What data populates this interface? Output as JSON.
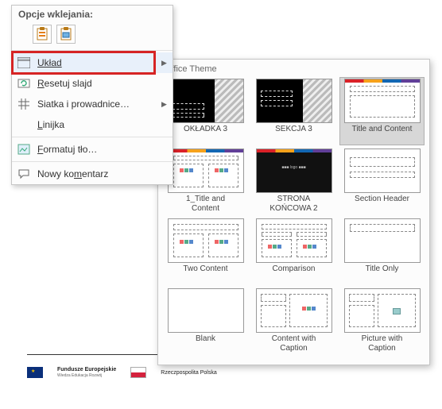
{
  "context_menu": {
    "paste_header": "Opcje wklejania:",
    "items": {
      "layout": {
        "label": "Układ",
        "has_submenu": true
      },
      "reset": {
        "label": "Resetuj slajd"
      },
      "grid": {
        "label": "Siatka i prowadnice…",
        "has_submenu": true
      },
      "ruler": {
        "label": "Linijka"
      },
      "format_bg": {
        "label": "Formatuj tło…"
      },
      "comment": {
        "label": "Nowy komentarz"
      }
    }
  },
  "flyout": {
    "title": "Office Theme",
    "layouts": [
      {
        "key": "okladka3",
        "label": "OKŁADKA 3",
        "kind": "cover-black"
      },
      {
        "key": "sekcja3",
        "label": "SEKCJA 3",
        "kind": "section-black"
      },
      {
        "key": "titlecontent",
        "label": "Title and Content",
        "kind": "title-content",
        "selected": true
      },
      {
        "key": "1title",
        "label": "1_Title and\nContent",
        "kind": "two-col-title"
      },
      {
        "key": "koncowa2",
        "label": "STRONA\nKOŃCOWA 2",
        "kind": "ending-black"
      },
      {
        "key": "secheader",
        "label": "Section Header",
        "kind": "section-header"
      },
      {
        "key": "twocontent",
        "label": "Two Content",
        "kind": "two-content"
      },
      {
        "key": "comparison",
        "label": "Comparison",
        "kind": "comparison"
      },
      {
        "key": "titleonly",
        "label": "Title Only",
        "kind": "title-only"
      },
      {
        "key": "blank",
        "label": "Blank",
        "kind": "blank"
      },
      {
        "key": "contentcap",
        "label": "Content with\nCaption",
        "kind": "content-caption"
      },
      {
        "key": "picturecap",
        "label": "Picture with\nCaption",
        "kind": "picture-caption"
      }
    ]
  },
  "footer": {
    "eu_label": "Fundusze\nEuropejskie",
    "eu_sub": "Wiedza Edukacja Rozwój",
    "pl_label": "Rzeczpospolita\nPolska"
  }
}
